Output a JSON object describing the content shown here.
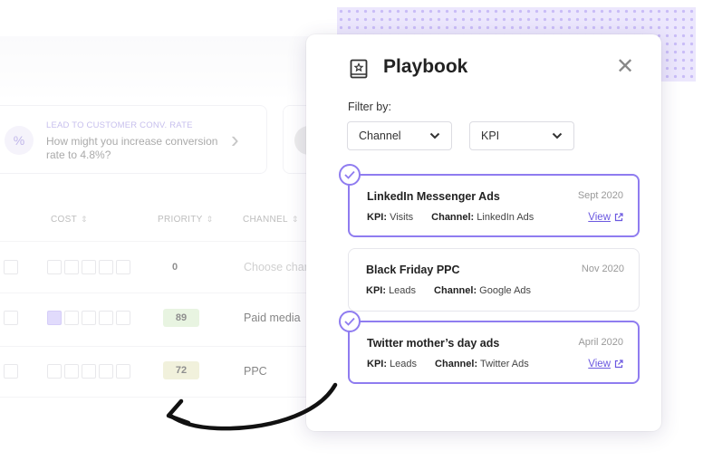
{
  "background": {
    "insight": {
      "icon_glyph": "%",
      "title": "LEAD TO CUSTOMER CONV. RATE",
      "text": "How might you increase conversion rate to 4.8%?"
    },
    "columns": {
      "cost": "COST",
      "priority": "PRIORITY",
      "channel": "CHANNEL"
    },
    "rows": [
      {
        "priority": "0",
        "channel": "Choose char",
        "cost_filled": 0
      },
      {
        "priority": "89",
        "channel": "Paid media",
        "cost_filled": 1
      },
      {
        "priority": "72",
        "channel": "PPC",
        "cost_filled": 0
      }
    ]
  },
  "playbook": {
    "title": "Playbook",
    "filter_label": "Filter by:",
    "filters": [
      {
        "label": "Channel"
      },
      {
        "label": "KPI"
      }
    ],
    "kpi_label": "KPI:",
    "channel_label": "Channel:",
    "view_label": "View",
    "items": [
      {
        "title": "LinkedIn Messenger Ads",
        "date": "Sept 2020",
        "kpi": "Visits",
        "channel": "LinkedIn Ads",
        "selected": true,
        "has_view": true
      },
      {
        "title": "Black Friday PPC",
        "date": "Nov 2020",
        "kpi": "Leads",
        "channel": "Google Ads",
        "selected": false,
        "has_view": false
      },
      {
        "title": "Twitter mother’s day ads",
        "date": "April 2020",
        "kpi": "Leads",
        "channel": "Twitter Ads",
        "selected": true,
        "has_view": true
      }
    ]
  },
  "colors": {
    "accent": "#8f7cf0",
    "link": "#6b58e0",
    "priority_high": "#d7ecc9",
    "priority_mid": "#e6e7c0"
  }
}
